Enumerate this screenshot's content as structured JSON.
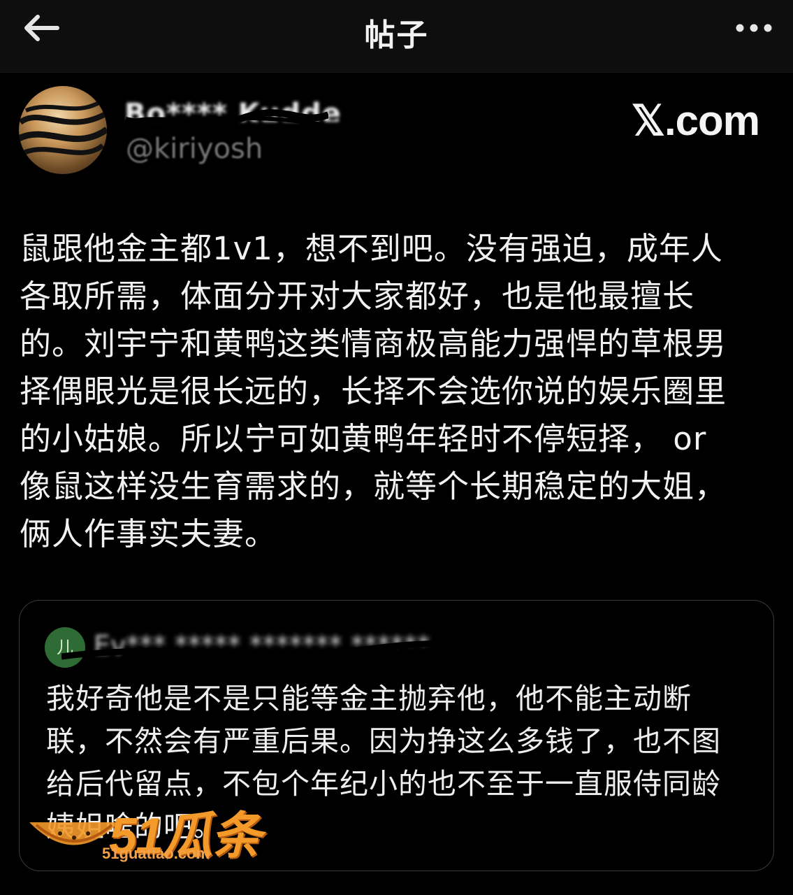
{
  "header": {
    "back_icon": "arrow-left-icon",
    "title": "帖子",
    "more_icon": "ellipsis-horizontal-icon"
  },
  "post": {
    "author_name": "Bo**** Kudde",
    "author_handle": "@kiriyosh",
    "source": "𝕏.com",
    "body_lines": [
      "鼠跟他金主都1v1，想不到吧。没有强迫，成年人",
      "各取所需，体面分开对大家都好，也是他最擅长",
      "的。刘宇宁和黄鸭这类情商极高能力强悍的草根男",
      "择偶眼光是很长远的，长择不会选你说的娱乐圈里",
      "的小姑娘。所以宁可如黄鸭年轻时不停短择， or",
      "像鼠这样没生育需求的，就等个长期稳定的大姐，",
      "俩人作事实夫妻。"
    ]
  },
  "quote": {
    "avatar_text": "儿",
    "author_text": "Ev*** ***** ******* ******",
    "body_lines": [
      "我好奇他是不是只能等金主抛弃他，他不能主动断",
      "联，不然会有严重后果。因为挣这么多钱了，也不图",
      "给后代留点，不包个年纪小的也不至于一直服侍同龄",
      "姨姐啥的吧。"
    ]
  },
  "watermark": {
    "logo": "51瓜条",
    "site": "51guatiao.com"
  },
  "colors": {
    "background": "#000000",
    "topbar": "#0e0e0e",
    "text": "#f1f1f1",
    "muted": "#777777",
    "card_border": "#3a3a3a",
    "watermark": "#f39a2a"
  }
}
